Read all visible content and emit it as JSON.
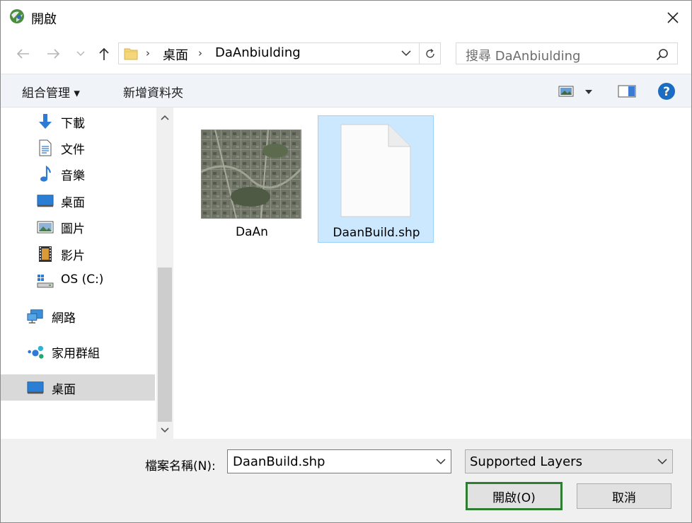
{
  "window": {
    "title": "開啟"
  },
  "address": {
    "crumbs": [
      "桌面",
      "DaAnbiulding"
    ]
  },
  "search": {
    "placeholder": "搜尋 DaAnbiulding"
  },
  "toolbar": {
    "organize_label": "組合管理 ▾",
    "new_folder_label": "新增資料夾"
  },
  "nav": {
    "items": [
      {
        "label": "下載",
        "icon": "download-icon"
      },
      {
        "label": "文件",
        "icon": "document-icon"
      },
      {
        "label": "音樂",
        "icon": "music-icon"
      },
      {
        "label": "桌面",
        "icon": "desktop-icon"
      },
      {
        "label": "圖片",
        "icon": "pictures-icon"
      },
      {
        "label": "影片",
        "icon": "videos-icon"
      },
      {
        "label": "OS (C:)",
        "icon": "drive-icon"
      },
      {
        "label": "網路",
        "icon": "network-icon"
      },
      {
        "label": "家用群組",
        "icon": "homegroup-icon"
      },
      {
        "label": "桌面",
        "icon": "desktop-icon"
      }
    ],
    "selected_index": 9
  },
  "files": [
    {
      "name": "DaAn",
      "type": "image"
    },
    {
      "name": "DaanBuild.shp",
      "type": "document"
    }
  ],
  "bottom": {
    "filename_label": "檔案名稱(N):",
    "filename_value": "DaanBuild.shp",
    "filter_value": "Supported Layers",
    "open_label": "開啟(O)",
    "cancel_label": "取消"
  },
  "colors": {
    "selection": "#cce8ff",
    "accent": "#0078d7",
    "open_highlight": "#2e7d32",
    "help": "#1a6dc2"
  }
}
